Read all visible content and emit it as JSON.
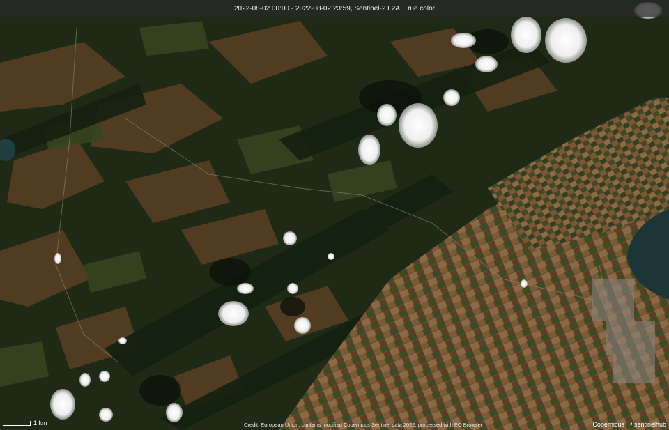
{
  "header": {
    "title": "2022-08-02 00:00 - 2022-08-02 23:59, Sentinel-2 L2A, True color"
  },
  "scale": {
    "label": "1 km"
  },
  "footer": {
    "credit": "Credit: European Union, contains modified Copernicus Sentinel data 2022, processed with EO Browser"
  },
  "logos": [
    {
      "icon": "copernicus-logo-icon",
      "label": "Copernicus"
    },
    {
      "icon": "sentinelhub-logo-icon",
      "label": "sentinelhub"
    }
  ],
  "colors": {
    "forest": "#1b2a15",
    "meadow": "#3a4a22",
    "field_brown": "#6b4a2c",
    "field_tan": "#8a6a45",
    "water": "#1c3536",
    "cloud": "#f4f4f4"
  }
}
